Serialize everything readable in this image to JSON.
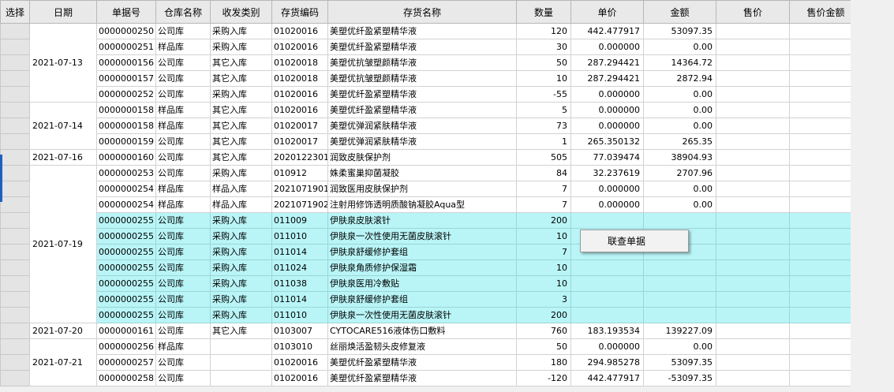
{
  "headers": [
    "选择",
    "日期",
    "单据号",
    "仓库名称",
    "收发类别",
    "存货编码",
    "存货名称",
    "数量",
    "单价",
    "金额",
    "售价",
    "售价金额"
  ],
  "date_groups": [
    {
      "date": "2021-07-13",
      "rows": 5
    },
    {
      "date": "2021-07-14",
      "rows": 3
    },
    {
      "date": "2021-07-16",
      "rows": 1
    },
    {
      "date": "2021-07-19",
      "rows": 10
    },
    {
      "date": "2021-07-20",
      "rows": 1
    },
    {
      "date": "2021-07-21",
      "rows": 3
    }
  ],
  "rows": [
    {
      "doc": "0000000250",
      "wh": "公司库",
      "type": "采购入库",
      "code": "01020016",
      "name": "美塑优纤盈紧塑精华液",
      "qty": "120",
      "price": "442.477917",
      "amount": "53097.35",
      "sale": "",
      "sale_amount": "",
      "hl": false
    },
    {
      "doc": "0000000251",
      "wh": "样品库",
      "type": "采购入库",
      "code": "01020016",
      "name": "美塑优纤盈紧塑精华液",
      "qty": "30",
      "price": "0.000000",
      "amount": "0.00",
      "sale": "",
      "sale_amount": "",
      "hl": false
    },
    {
      "doc": "0000000156",
      "wh": "公司库",
      "type": "其它入库",
      "code": "01020018",
      "name": "美塑优抗皱塑颜精华液",
      "qty": "50",
      "price": "287.294421",
      "amount": "14364.72",
      "sale": "",
      "sale_amount": "",
      "hl": false
    },
    {
      "doc": "0000000157",
      "wh": "公司库",
      "type": "其它入库",
      "code": "01020018",
      "name": "美塑优抗皱塑颜精华液",
      "qty": "10",
      "price": "287.294421",
      "amount": "2872.94",
      "sale": "",
      "sale_amount": "",
      "hl": false
    },
    {
      "doc": "0000000252",
      "wh": "公司库",
      "type": "采购入库",
      "code": "01020016",
      "name": "美塑优纤盈紧塑精华液",
      "qty": "-55",
      "price": "0.000000",
      "amount": "0.00",
      "sale": "",
      "sale_amount": "",
      "hl": false
    },
    {
      "doc": "0000000158",
      "wh": "样品库",
      "type": "其它入库",
      "code": "01020016",
      "name": "美塑优纤盈紧塑精华液",
      "qty": "5",
      "price": "0.000000",
      "amount": "0.00",
      "sale": "",
      "sale_amount": "",
      "hl": false
    },
    {
      "doc": "0000000158",
      "wh": "样品库",
      "type": "其它入库",
      "code": "01020017",
      "name": "美塑优弹润紧肤精华液",
      "qty": "73",
      "price": "0.000000",
      "amount": "0.00",
      "sale": "",
      "sale_amount": "",
      "hl": false
    },
    {
      "doc": "0000000159",
      "wh": "公司库",
      "type": "其它入库",
      "code": "01020017",
      "name": "美塑优弹润紧肤精华液",
      "qty": "1",
      "price": "265.350132",
      "amount": "265.35",
      "sale": "",
      "sale_amount": "",
      "hl": false
    },
    {
      "doc": "0000000160",
      "wh": "公司库",
      "type": "其它入库",
      "code": "2020122301",
      "name": "润致皮肤保护剂",
      "qty": "505",
      "price": "77.039474",
      "amount": "38904.93",
      "sale": "",
      "sale_amount": "",
      "hl": false
    },
    {
      "doc": "0000000253",
      "wh": "公司库",
      "type": "采购入库",
      "code": "010912",
      "name": "姝柔蜜巢抑菌凝胶",
      "qty": "84",
      "price": "32.237619",
      "amount": "2707.96",
      "sale": "",
      "sale_amount": "",
      "hl": false
    },
    {
      "doc": "0000000254",
      "wh": "样品库",
      "type": "样品入库",
      "code": "2021071901",
      "name": "润致医用皮肤保护剂",
      "qty": "7",
      "price": "0.000000",
      "amount": "0.00",
      "sale": "",
      "sale_amount": "",
      "hl": false
    },
    {
      "doc": "0000000254",
      "wh": "样品库",
      "type": "样品入库",
      "code": "2021071902",
      "name": "注射用修饰透明质酸钠凝胶Aqua型",
      "qty": "7",
      "price": "0.000000",
      "amount": "0.00",
      "sale": "",
      "sale_amount": "",
      "hl": false
    },
    {
      "doc": "0000000255",
      "wh": "公司库",
      "type": "采购入库",
      "code": "011009",
      "name": "伊肤泉皮肤滚针",
      "qty": "200",
      "price": "",
      "amount": "",
      "sale": "",
      "sale_amount": "",
      "hl": true
    },
    {
      "doc": "0000000255",
      "wh": "公司库",
      "type": "采购入库",
      "code": "011010",
      "name": "伊肤泉一次性使用无菌皮肤滚针",
      "qty": "10",
      "price": "",
      "amount": "",
      "sale": "",
      "sale_amount": "",
      "hl": true
    },
    {
      "doc": "0000000255",
      "wh": "公司库",
      "type": "采购入库",
      "code": "011014",
      "name": "伊肤泉舒缓修护套组",
      "qty": "7",
      "price": "",
      "amount": "",
      "sale": "",
      "sale_amount": "",
      "hl": true
    },
    {
      "doc": "0000000255",
      "wh": "公司库",
      "type": "采购入库",
      "code": "011024",
      "name": "伊肤泉角质修护保湿霜",
      "qty": "10",
      "price": "",
      "amount": "",
      "sale": "",
      "sale_amount": "",
      "hl": true
    },
    {
      "doc": "0000000255",
      "wh": "公司库",
      "type": "采购入库",
      "code": "011038",
      "name": "伊肤泉医用冷敷贴",
      "qty": "10",
      "price": "",
      "amount": "",
      "sale": "",
      "sale_amount": "",
      "hl": true
    },
    {
      "doc": "0000000255",
      "wh": "公司库",
      "type": "采购入库",
      "code": "011014",
      "name": "伊肤泉舒缓修护套组",
      "qty": "3",
      "price": "",
      "amount": "",
      "sale": "",
      "sale_amount": "",
      "hl": true
    },
    {
      "doc": "0000000255",
      "wh": "公司库",
      "type": "采购入库",
      "code": "011010",
      "name": "伊肤泉一次性使用无菌皮肤滚针",
      "qty": "200",
      "price": "",
      "amount": "",
      "sale": "",
      "sale_amount": "",
      "hl": true
    },
    {
      "doc": "0000000161",
      "wh": "公司库",
      "type": "其它入库",
      "code": "0103007",
      "name": "CYTOCARE516液体伤口敷料",
      "qty": "760",
      "price": "183.193534",
      "amount": "139227.09",
      "sale": "",
      "sale_amount": "",
      "hl": false
    },
    {
      "doc": "0000000256",
      "wh": "样品库",
      "type": "",
      "code": "0103010",
      "name": "丝丽焕活盈韧头皮修复液",
      "qty": "50",
      "price": "0.000000",
      "amount": "0.00",
      "sale": "",
      "sale_amount": "",
      "hl": false
    },
    {
      "doc": "0000000257",
      "wh": "公司库",
      "type": "",
      "code": "01020016",
      "name": "美塑优纤盈紧塑精华液",
      "qty": "180",
      "price": "294.985278",
      "amount": "53097.35",
      "sale": "",
      "sale_amount": "",
      "hl": false
    },
    {
      "doc": "0000000258",
      "wh": "公司库",
      "type": "",
      "code": "01020016",
      "name": "美塑优纤盈紧塑精华液",
      "qty": "-120",
      "price": "442.477917",
      "amount": "-53097.35",
      "sale": "",
      "sale_amount": "",
      "hl": false
    }
  ],
  "context_menu": {
    "item": "联查单据"
  }
}
